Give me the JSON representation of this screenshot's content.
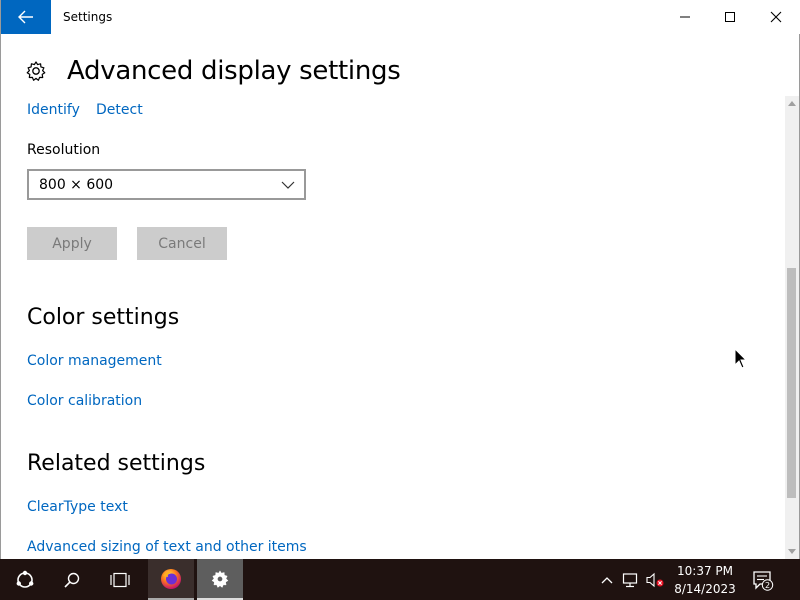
{
  "window": {
    "title": "Settings"
  },
  "page": {
    "title": "Advanced display settings",
    "links_top": [
      "Identify",
      "Detect"
    ],
    "resolution_label": "Resolution",
    "resolution_value": "800 × 600",
    "apply_label": "Apply",
    "cancel_label": "Cancel"
  },
  "color_section": {
    "title": "Color settings",
    "links": [
      "Color management",
      "Color calibration"
    ]
  },
  "related_section": {
    "title": "Related settings",
    "links": [
      "ClearType text",
      "Advanced sizing of text and other items"
    ]
  },
  "taskbar": {
    "time": "10:37 PM",
    "date": "8/14/2023",
    "notification_count": "2"
  },
  "colors": {
    "accent": "#0067c0",
    "taskbar": "#1f1210"
  }
}
